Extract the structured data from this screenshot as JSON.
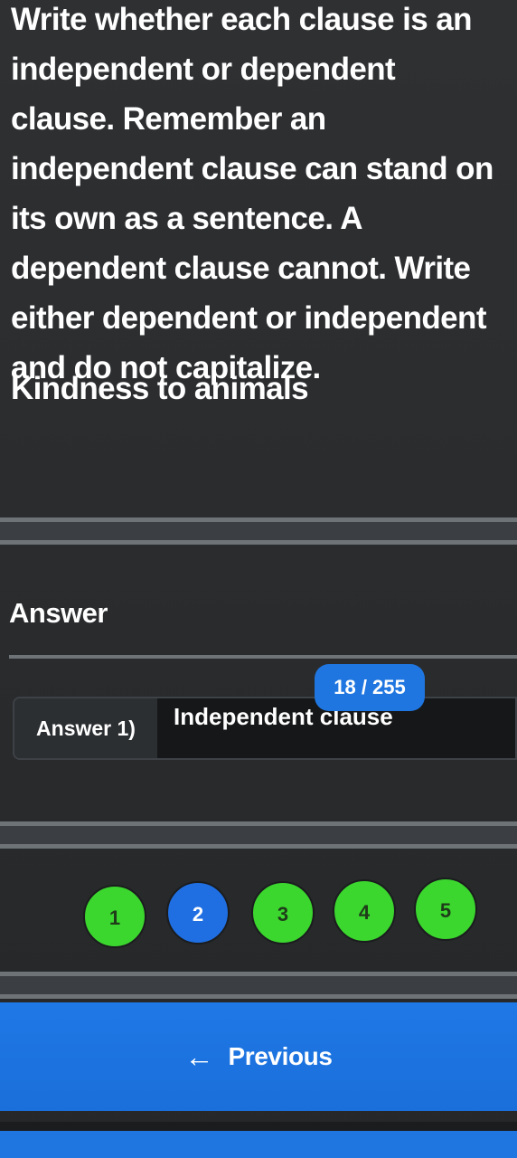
{
  "instructions": "Write whether each clause is an independent or dependent clause. Remember an independent clause can stand on its own as a sentence. A dependent clause cannot. Write either dependent or independent and do not capitalize.",
  "question": "Kindness to animals",
  "answer_section": {
    "heading": "Answer",
    "counter": "18 / 255",
    "row_label": "Answer 1)",
    "value": "Independent clause"
  },
  "navigation": {
    "items": [
      {
        "label": "1",
        "state": "done",
        "color": "#3bd62e"
      },
      {
        "label": "2",
        "state": "current",
        "color": "#1f6fe3"
      },
      {
        "label": "3",
        "state": "done",
        "color": "#3bd62e"
      },
      {
        "label": "4",
        "state": "done",
        "color": "#3bd62e"
      },
      {
        "label": "5",
        "state": "done",
        "color": "#3bd62e"
      }
    ]
  },
  "previous_button": {
    "label": "Previous",
    "icon": "arrow-left-icon"
  },
  "colors": {
    "accent": "#1f76e0",
    "success": "#3bd62e",
    "background": "#2b2d2f"
  }
}
